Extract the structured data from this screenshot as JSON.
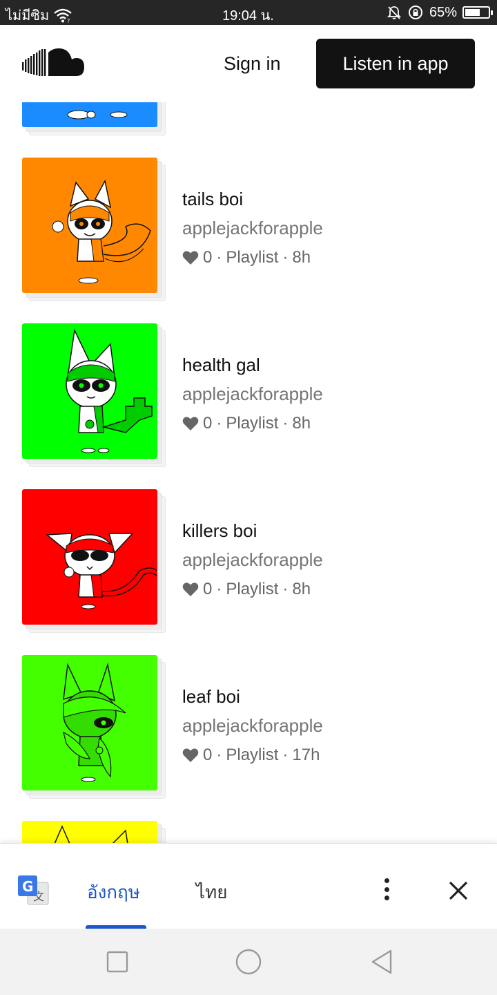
{
  "status_bar": {
    "carrier": "ไม่มีซิม",
    "time": "19:04 น.",
    "battery": "65%",
    "battery_level": 0.65,
    "icons": [
      "wifi-icon",
      "bell-muted-icon",
      "rotation-lock-icon",
      "battery-icon"
    ]
  },
  "header": {
    "logo": "soundcloud-logo",
    "sign_in": "Sign in",
    "listen_in_app": "Listen in app"
  },
  "playlists": [
    {
      "title": "tails boi",
      "artist": "applejackforapple",
      "likes": "0",
      "type": "Playlist",
      "age": "8h",
      "cover_color": "#ff8800"
    },
    {
      "title": "health gal",
      "artist": "applejackforapple",
      "likes": "0",
      "type": "Playlist",
      "age": "8h",
      "cover_color": "#00ff00"
    },
    {
      "title": "killers boi",
      "artist": "applejackforapple",
      "likes": "0",
      "type": "Playlist",
      "age": "8h",
      "cover_color": "#ff0000"
    },
    {
      "title": "leaf boi",
      "artist": "applejackforapple",
      "likes": "0",
      "type": "Playlist",
      "age": "17h",
      "cover_color": "#44ff00"
    }
  ],
  "partial_items": {
    "top_cover_color": "#1a8cff",
    "bottom_cover_color": "#ffff00"
  },
  "separator": "·",
  "translate_bar": {
    "source_lang": "อังกฤษ",
    "target_lang": "ไทย",
    "icon": "google-translate-icon"
  },
  "nav_bar": {
    "buttons": [
      "recents-icon",
      "home-icon",
      "back-icon"
    ]
  }
}
